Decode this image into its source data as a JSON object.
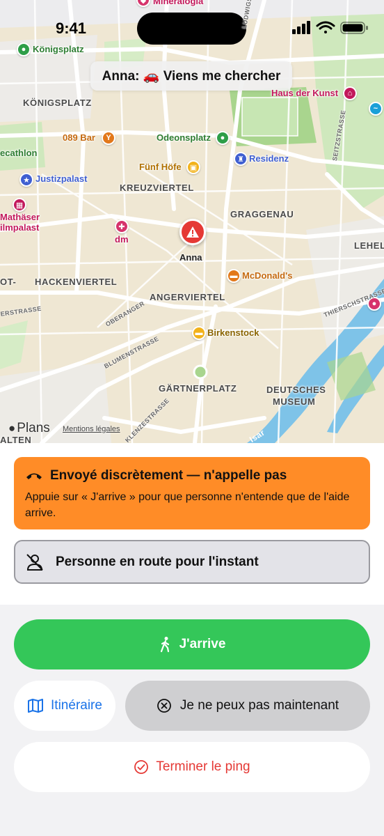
{
  "status_bar": {
    "time": "9:41"
  },
  "map": {
    "callout": "Anna: 🚗 Viens me chercher",
    "user_pin_label": "Anna",
    "attribution": "Plans",
    "legal": "Mentions légales",
    "pois": [
      {
        "id": "mineralogia",
        "label": "Mineralogia",
        "color": "#d6336c"
      },
      {
        "id": "konigsplatz-poi",
        "label": "Königsplatz",
        "color": "#2e9e48"
      },
      {
        "id": "haus-der-kunst",
        "label": "Haus der Kunst",
        "color": "#c2185b"
      },
      {
        "id": "bar-089",
        "label": "089 Bar",
        "color": "#e2781a"
      },
      {
        "id": "odeonsplatz",
        "label": "Odeonsplatz",
        "color": "#2e9e48"
      },
      {
        "id": "residenz",
        "label": "Residenz",
        "color": "#3f5fd1"
      },
      {
        "id": "decathlon",
        "label": "ecathlon",
        "color": "#2e9e48"
      },
      {
        "id": "funf-hofe",
        "label": "Fünf Höfe",
        "color": "#d48a00"
      },
      {
        "id": "justizpalast",
        "label": "Justizpalast",
        "color": "#3f5fd1"
      },
      {
        "id": "mathaser",
        "label": "Mathäser\nilmpalast",
        "color": "#c2185b"
      },
      {
        "id": "dm",
        "label": "dm",
        "color": "#d6336c"
      },
      {
        "id": "mcdonalds",
        "label": "McDonald's",
        "color": "#e2781a"
      },
      {
        "id": "birkenstock",
        "label": "Birkenstock",
        "color": "#a07400"
      }
    ],
    "districts": [
      "KÖNIGSPLATZ",
      "KREUZVIERTEL",
      "GRAGGENAU",
      "LEHEL",
      "HACKENVIERTEL",
      "ANGERVIERTEL",
      "GÄRTNERPLATZ",
      "DEUTSCHES",
      "MUSEUM",
      "OT-",
      "ALTEN"
    ],
    "streets": [
      "LUDWIGSTRASSE",
      "SEITZSTRASSE",
      "OBERANGER",
      "BLUMENSTRASSE",
      "THIERSCHSTRASSE",
      "ERSTRASSE",
      "KLENZESTRASSE",
      "Isar"
    ]
  },
  "alert": {
    "title": "Envoyé discrètement — n'appelle pas",
    "body": "Appuie sur « J'arrive » pour que personne n'entende que de l'aide arrive."
  },
  "status_card": {
    "text": "Personne en route pour l'instant"
  },
  "actions": {
    "arrive": "J'arrive",
    "route": "Itinéraire",
    "cannot": "Je ne peux pas maintenant",
    "end": "Terminer le ping"
  },
  "colors": {
    "alert_bg": "#ff8c27",
    "arrive_green": "#34c759",
    "link_blue": "#1a73e8",
    "danger_red": "#e53935"
  }
}
